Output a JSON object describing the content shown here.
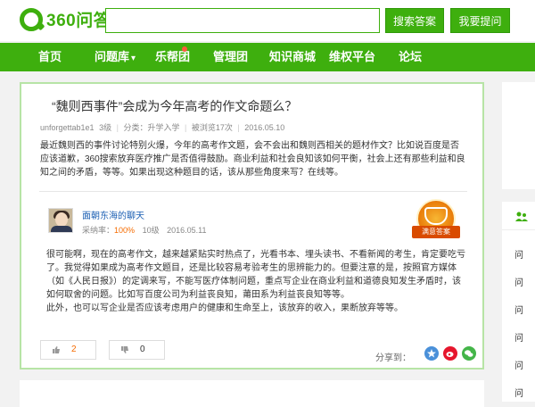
{
  "header": {
    "logo_text": "360问答",
    "search_placeholder": "",
    "search_button": "搜索答案",
    "ask_button": "我要提问"
  },
  "nav": {
    "items": [
      {
        "label": "首页"
      },
      {
        "label": "问题库",
        "has_dropdown": true
      },
      {
        "label": "乐帮团",
        "has_dot": true
      },
      {
        "label": "管理团"
      },
      {
        "label": "知识商城"
      },
      {
        "label": "维权平台"
      },
      {
        "label": "论坛"
      }
    ],
    "dropdown_glyph": "▾"
  },
  "question": {
    "title": "“魏则西事件”会成为今年高考的作文命题么？",
    "author": "unforgettab1e1",
    "level": "3级",
    "category": "分类：升学入学",
    "views": "被浏览17次",
    "date": "2016.05.10",
    "body": "最近魏则西的事件讨论特别火爆，今年的高考作文题，会不会出和魏则西相关的题材作文？比如说百度是否应该道歉，360搜索放弃医疗推广是否值得鼓励。商业利益和社会良知该如何平衡，社会上还有那些利益和良知之间的矛盾，等等。如果出现这种题目的话，该从那些角度来写？在线等。"
  },
  "answer": {
    "answerer": "面朝东海的聊天",
    "adopt_label": "采纳率：",
    "adopt_rate": "100%",
    "level": "10级",
    "date": "2016.05.11",
    "badge_text": "满意答案",
    "paragraph1": "很可能啊，现在的高考作文，越来越紧贴实时热点了，光看书本、埋头读书、不看新闻的考生，肯定要吃亏了。我觉得如果成为高考作文题目，还是比较容易考验考生的思辨能力的。但要注意的是，按照官方媒体（如《人民日报》）的定调来写，不能写医疗体制问题，重点写企业在商业利益和道德良知发生矛盾时，该如何取舍的问题。比如写百度公司为利益丧良知，莆田系为利益丧良知等等。",
    "paragraph2": "此外，也可以写企业是否应该考虑用户的健康和生命至上，该放弃的收入，果断放弃等等。",
    "upvotes": "2",
    "downvotes": "0",
    "share_label": "分享到："
  },
  "sidebar": {
    "questions": [
      "问",
      "问",
      "问",
      "问",
      "问",
      "问"
    ]
  },
  "colors": {
    "brand_green": "#3eaf0e",
    "accent_orange": "#f56b00",
    "link_blue": "#1b5fb3"
  }
}
